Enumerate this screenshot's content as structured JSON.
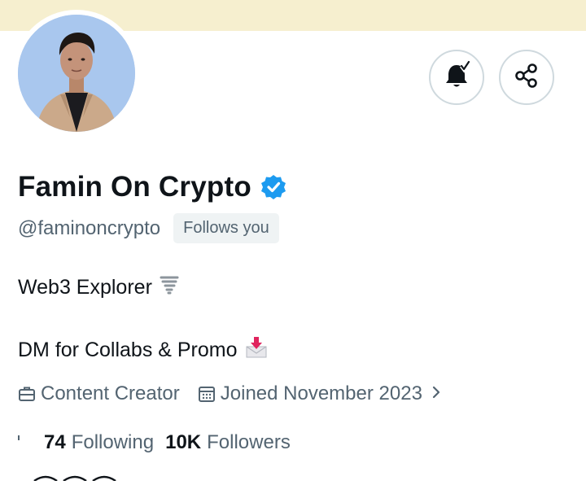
{
  "profile": {
    "display_name": "Famin On Crypto",
    "handle": "@faminoncrypto",
    "follows_you": "Follows you",
    "verified": true
  },
  "bio": {
    "line1": "Web3 Explorer",
    "line1_emoji": "🌪",
    "line2": "DM for Collabs & Promo",
    "line2_emoji": "📩"
  },
  "meta": {
    "category": "Content Creator",
    "joined": "Joined November 2023"
  },
  "stats": {
    "following_count": "74",
    "following_label": "Following",
    "followers_count": "10K",
    "followers_label": "Followers"
  },
  "colors": {
    "banner": "#f6efcf",
    "verified_blue": "#1d9bf0",
    "secondary_text": "#536471",
    "primary_text": "#0f1419",
    "button_border": "#cfd9de"
  },
  "icons": {
    "notify": "bell-check-icon",
    "share": "share-icon",
    "category": "briefcase-icon",
    "joined": "calendar-icon",
    "expand": "chevron-right-icon"
  }
}
